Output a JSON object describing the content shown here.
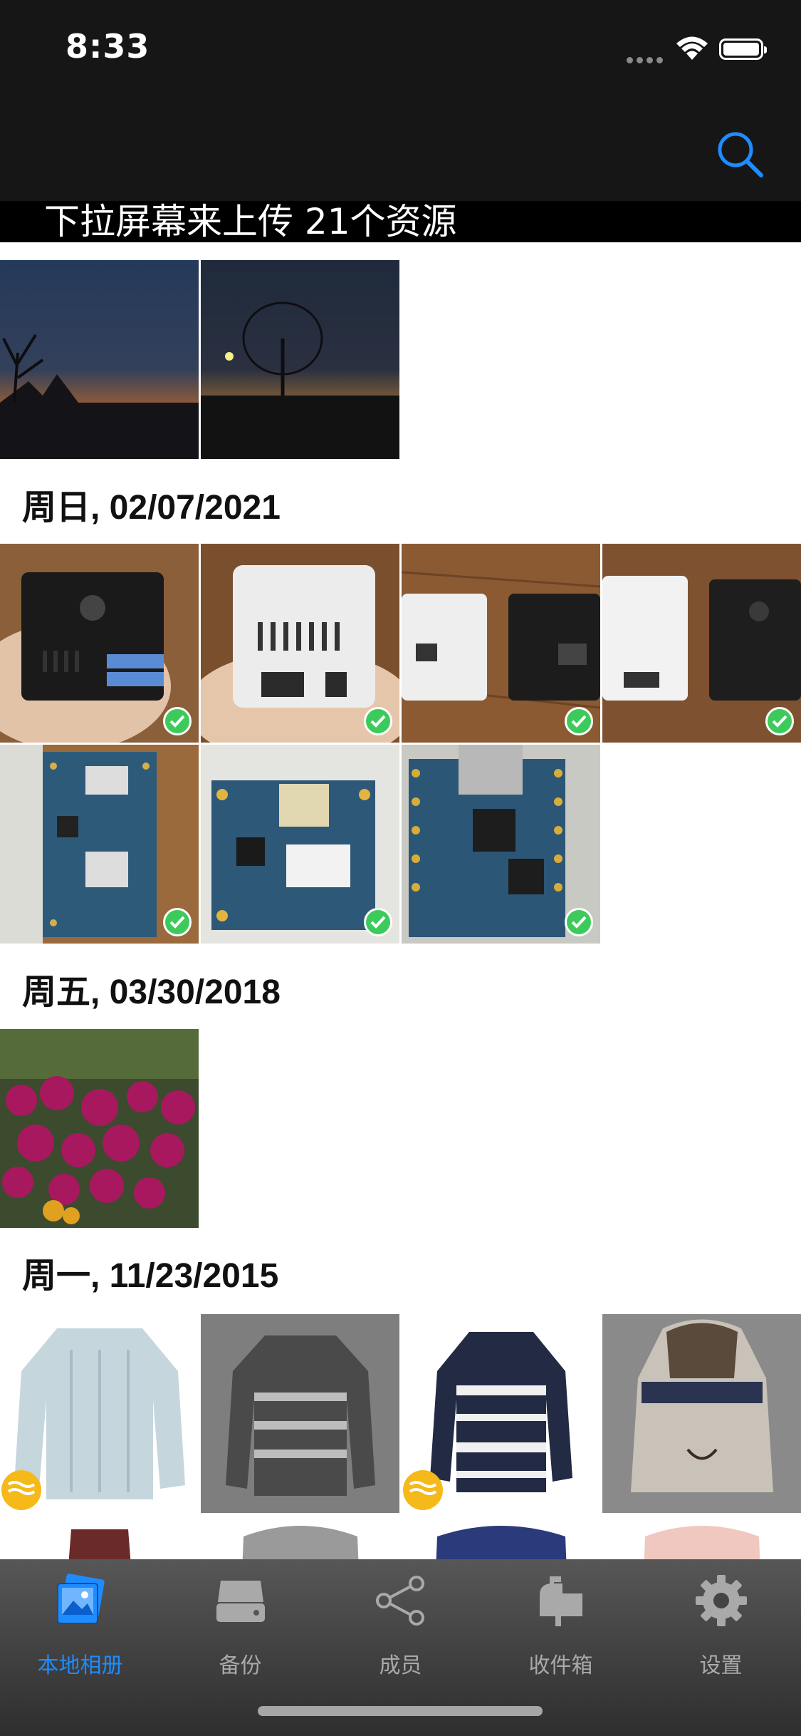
{
  "status_bar": {
    "time": "8:33"
  },
  "banner": {
    "text": "下拉屏幕来上传 21个资源"
  },
  "sections": [
    {
      "date": ""
    },
    {
      "date": "周日, 02/07/2021"
    },
    {
      "date": "周五, 03/30/2018"
    },
    {
      "date": "周一, 11/23/2015"
    }
  ],
  "tabs": [
    {
      "label": "本地相册",
      "icon": "photo-album-icon",
      "active": true
    },
    {
      "label": "备份",
      "icon": "drive-icon",
      "active": false
    },
    {
      "label": "成员",
      "icon": "share-icon",
      "active": false
    },
    {
      "label": "收件箱",
      "icon": "inbox-icon",
      "active": false
    },
    {
      "label": "设置",
      "icon": "gear-icon",
      "active": false
    }
  ],
  "colors": {
    "accent": "#1e8cff",
    "check": "#3ccb5b",
    "live_badge": "#f6b91a",
    "nav_bg": "#161616"
  }
}
